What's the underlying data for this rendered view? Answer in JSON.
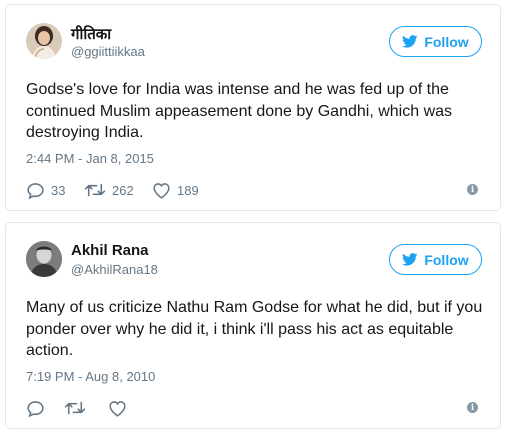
{
  "tweets": [
    {
      "display_name": "गीतिका",
      "handle": "@ggiittiikkaa",
      "follow_label": "Follow",
      "text": "Godse's love for India was intense and he was fed up of the continued Muslim appeasement done by Gandhi, which was destroying India.",
      "timestamp": "2:44 PM - Jan 8, 2015",
      "replies": "33",
      "retweets": "262",
      "likes": "189"
    },
    {
      "display_name": "Akhil Rana",
      "handle": "@AkhilRana18",
      "follow_label": "Follow",
      "text": "Many of us criticize Nathu Ram Godse for what he did, but if you ponder over why he did it, i think i'll pass his act as equitable action.",
      "timestamp": "7:19 PM - Aug 8, 2010",
      "replies": "",
      "retweets": "",
      "likes": ""
    }
  ],
  "icons": {
    "follow": "twitter-bird-icon",
    "reply": "reply-icon",
    "retweet": "retweet-icon",
    "like": "heart-icon",
    "info": "info-icon"
  },
  "colors": {
    "accent": "#1da1f2",
    "secondary_text": "#657786",
    "border": "#e1e8ed"
  }
}
